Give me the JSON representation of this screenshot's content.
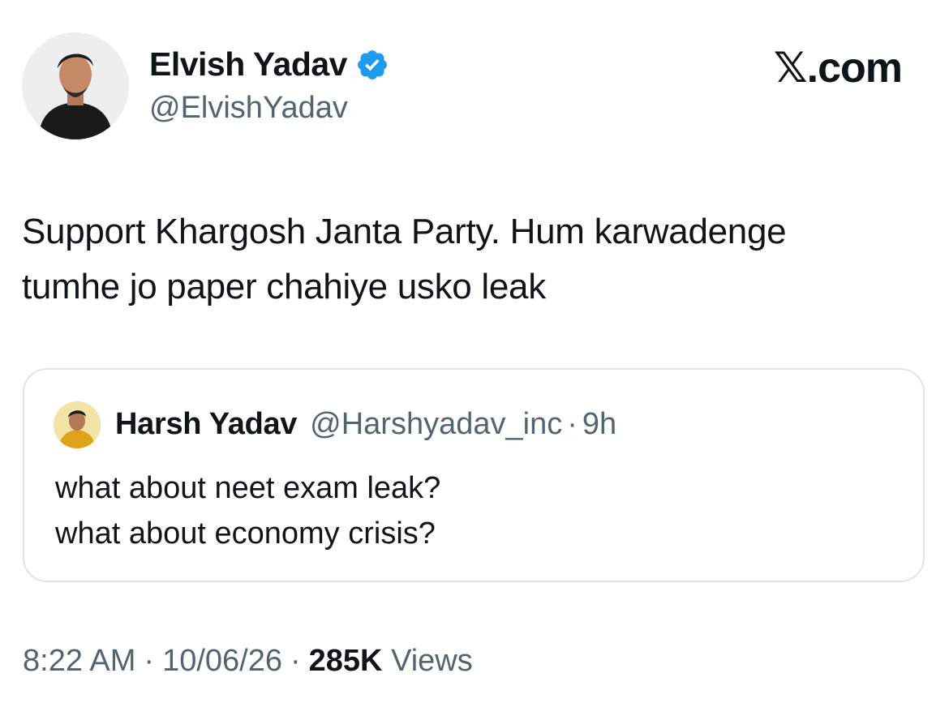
{
  "author": {
    "name": "Elvish Yadav",
    "handle": "@ElvishYadav",
    "verified": true,
    "avatar_icon": "profile-photo"
  },
  "brand": {
    "x_glyph": "𝕏",
    "suffix": ".com"
  },
  "tweet": {
    "text": "Support Khargosh Janta Party. Hum karwadenge\ntumhe jo paper chahiye usko leak"
  },
  "quoted_tweet": {
    "name": "Harsh Yadav",
    "handle": "@Harshyadav_inc",
    "separator": "·",
    "time": "9h",
    "text": "what about neet exam leak?\nwhat about economy crisis?",
    "avatar_icon": "profile-photo"
  },
  "meta": {
    "time": "8:22 AM",
    "date": "10/06/26",
    "separator": "·",
    "views_count": "285K",
    "views_label": "Views"
  },
  "colors": {
    "text_primary": "#0f1419",
    "text_secondary": "#536471",
    "verified_blue": "#1d9bf0",
    "border": "#e1e4e8"
  }
}
